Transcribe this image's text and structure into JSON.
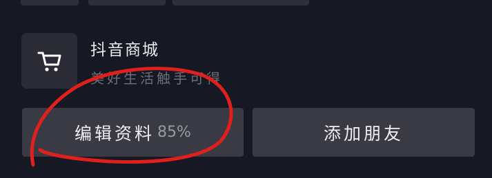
{
  "mall": {
    "icon": "shopping-cart-icon",
    "title": "抖音商城",
    "subtitle": "美好生活触手可得"
  },
  "actions": {
    "edit_profile_label": "编辑资料",
    "edit_profile_completion": "85%",
    "add_friend_label": "添加朋友"
  },
  "colors": {
    "background": "#161823",
    "button": "#3a3a45",
    "annotation": "#e0201c"
  }
}
